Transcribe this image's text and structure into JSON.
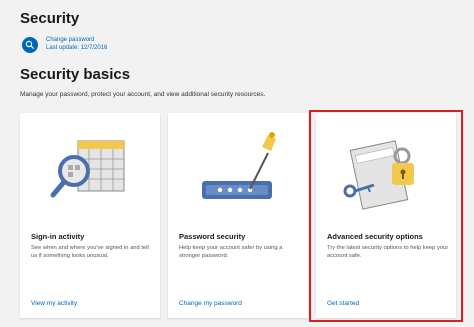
{
  "header": {
    "title": "Security",
    "change_password": "Change password",
    "last_update": "Last update: 12/7/2016"
  },
  "basics": {
    "title": "Security basics",
    "description": "Manage your password, protect your account, and view additional security resources."
  },
  "cards": [
    {
      "title": "Sign-in activity",
      "description": "See when and where you've signed in and tell us if something looks unusual.",
      "link": "View my activity",
      "icon": "calendar-magnifier-icon"
    },
    {
      "title": "Password security",
      "description": "Help keep your account safer by using a stronger password.",
      "link": "Change my password",
      "icon": "password-pen-icon"
    },
    {
      "title": "Advanced security options",
      "description": "Try the latest security options to help keep your account safe.",
      "link": "Get started",
      "icon": "lock-key-icon"
    }
  ],
  "colors": {
    "accent": "#0067b8",
    "highlight": "#d61f26",
    "background": "#f2f2f2"
  }
}
